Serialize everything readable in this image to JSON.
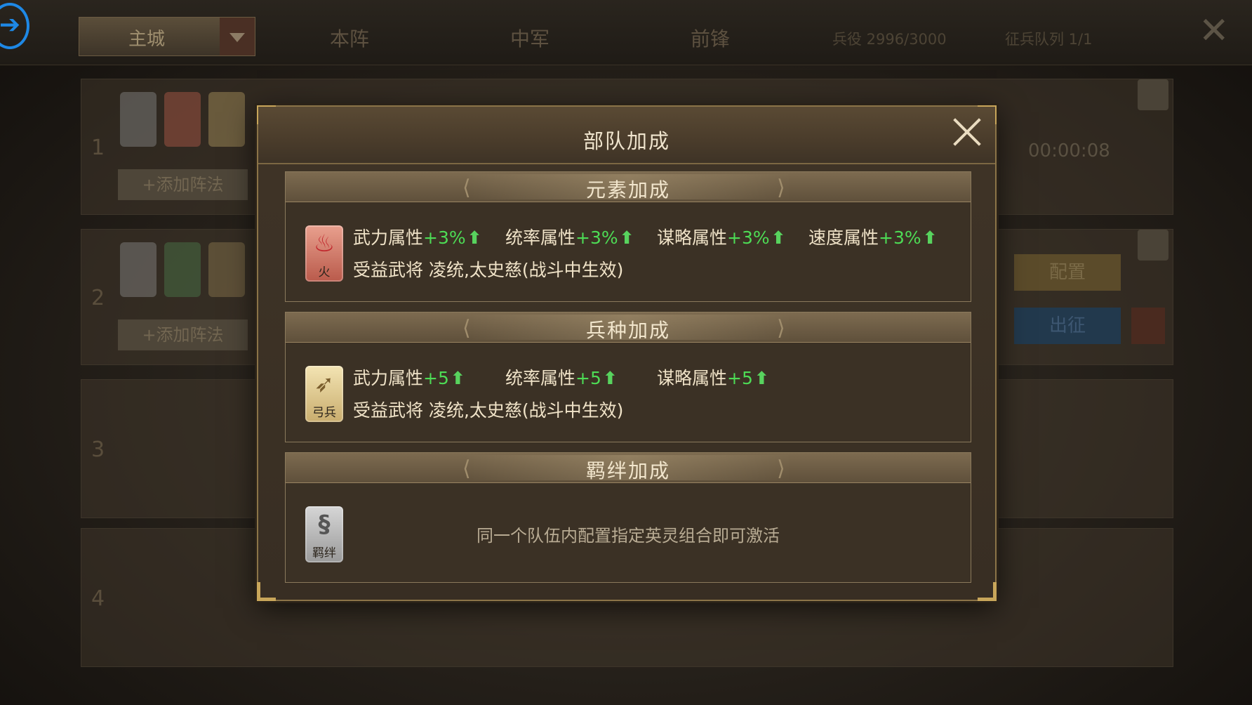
{
  "background": {
    "city_select": "主城",
    "tabs": [
      "本阵",
      "中军",
      "前锋"
    ],
    "troops": "兵役 2996/3000",
    "queue": "征兵队列 1/1",
    "slot_numbers": [
      "1",
      "2",
      "3",
      "4"
    ],
    "add_formation": "+添加阵法",
    "timer": "00:00:08",
    "config": "配置",
    "go": "出征"
  },
  "modal": {
    "title": "部队加成",
    "sections": [
      {
        "title": "元素加成",
        "badge_label": "火",
        "badge_icon": "fire-icon",
        "stats": [
          {
            "name": "武力属性",
            "value": "+3%"
          },
          {
            "name": "统率属性",
            "value": "+3%"
          },
          {
            "name": "谋略属性",
            "value": "+3%"
          },
          {
            "name": "速度属性",
            "value": "+3%"
          }
        ],
        "beneficiary": "受益武将 凌统,太史慈(战斗中生效)"
      },
      {
        "title": "兵种加成",
        "badge_label": "弓兵",
        "badge_icon": "bow-icon",
        "stats": [
          {
            "name": "武力属性",
            "value": "+5"
          },
          {
            "name": "统率属性",
            "value": "+5"
          },
          {
            "name": "谋略属性",
            "value": "+5"
          }
        ],
        "beneficiary": "受益武将 凌统,太史慈(战斗中生效)"
      },
      {
        "title": "羁绊加成",
        "badge_label": "羁绊",
        "badge_icon": "bond-icon",
        "description": "同一个队伍内配置指定英灵组合即可激活"
      }
    ]
  },
  "colors": {
    "stat_value": "#4ddb55",
    "text": "#f0e3c8",
    "frame_gold": "#c8a65a"
  }
}
